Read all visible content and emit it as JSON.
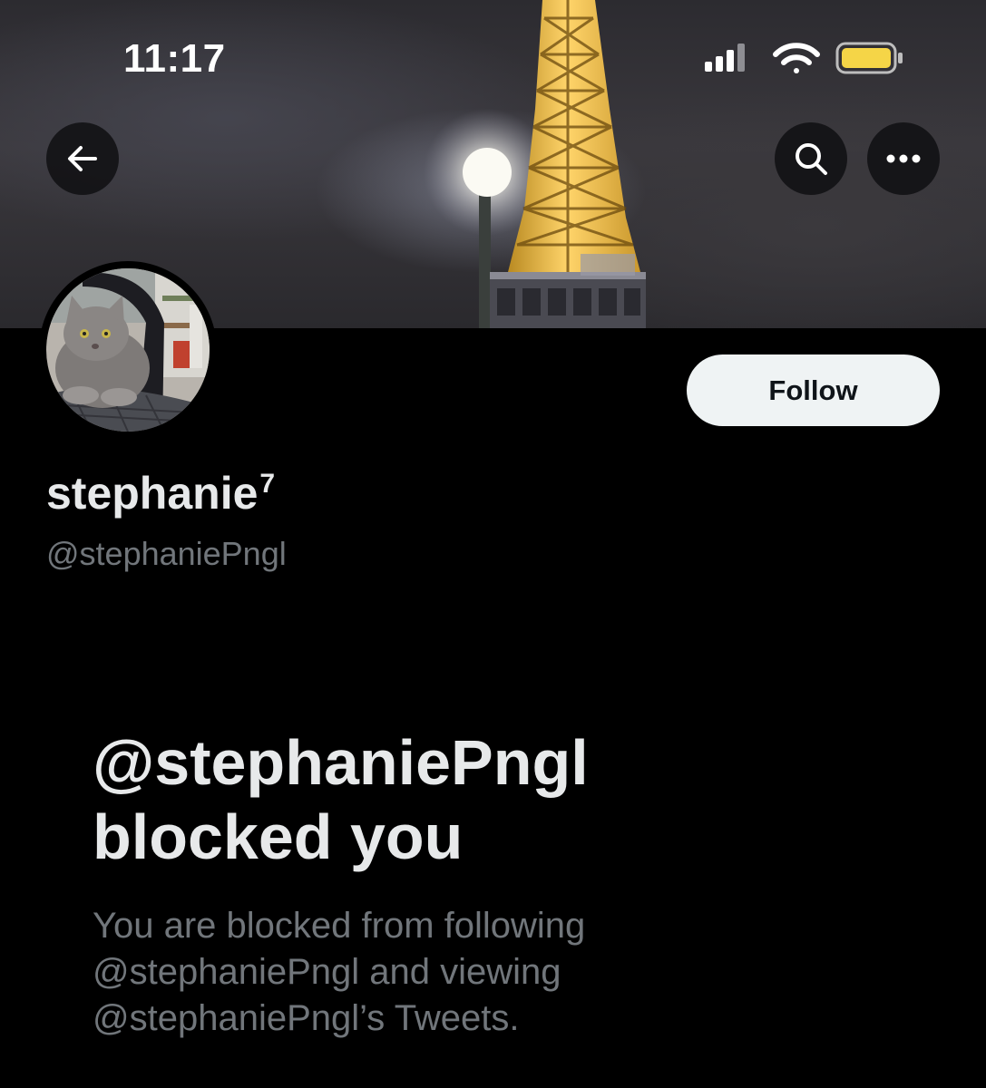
{
  "status_bar": {
    "time": "11:17",
    "signal_icon": "cellular-signal-icon",
    "wifi_icon": "wifi-icon",
    "battery_icon": "battery-icon",
    "battery_color": "#f5d547"
  },
  "nav": {
    "back_icon": "arrow-left-icon",
    "search_icon": "search-icon",
    "more_icon": "more-dots-icon"
  },
  "profile": {
    "display_name": "stephanie",
    "display_name_suffix": "7",
    "handle": "@stephaniePngl",
    "follow_label": "Follow"
  },
  "blocked": {
    "title_line1": "@stephaniePngl",
    "title_line2": "blocked you",
    "desc_line1": "You are blocked from following",
    "desc_line2": "@stephaniePngl and viewing",
    "desc_line3": "@stephaniePngl’s Tweets."
  },
  "colors": {
    "background": "#000000",
    "primary_text": "#e7e9ea",
    "secondary_text": "#71767b",
    "follow_button_bg": "#eff3f4"
  }
}
